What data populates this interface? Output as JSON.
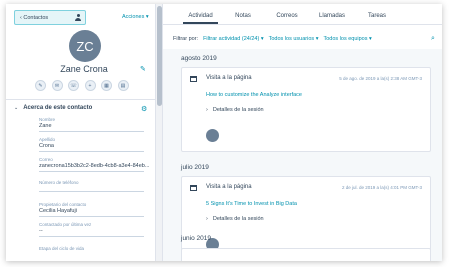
{
  "header": {
    "contacts_label": "‹ Contactos",
    "actions_label": "Acciones ▾"
  },
  "contact": {
    "initials": "ZC",
    "name": "Zane Crona"
  },
  "quick_actions": [
    "email-icon",
    "mail-icon",
    "phone-icon",
    "add-icon",
    "calendar-icon",
    "document-icon"
  ],
  "about": {
    "title": "Acerca de este contacto",
    "fields": [
      {
        "label": "Nombre",
        "value": "Zane"
      },
      {
        "label": "Apellido",
        "value": "Crona"
      },
      {
        "label": "Correo",
        "value": "zanecrona15b3b2c2-8edb-4cb8-a3e4-84eb..."
      },
      {
        "label": "Número de teléfono",
        "value": ""
      },
      {
        "label": "Propietario del contacto",
        "value": "Cecilia Hayafuji"
      },
      {
        "label": "Contactado por última vez",
        "value": "--"
      },
      {
        "label": "Etapa del ciclo de vida",
        "value": ""
      }
    ]
  },
  "tabs": [
    {
      "label": "Actividad",
      "active": true
    },
    {
      "label": "Notas",
      "active": false
    },
    {
      "label": "Correos",
      "active": false
    },
    {
      "label": "Llamadas",
      "active": false
    },
    {
      "label": "Tareas",
      "active": false
    }
  ],
  "filters": {
    "label": "Filtrar por:",
    "activity": "Filtrar actividad (24/24) ▾",
    "users": "Todos los usuarios ▾",
    "teams": "Todos los equipos ▾"
  },
  "timeline": [
    {
      "month": "agosto 2019",
      "title": "Visita a la página",
      "date": "5 de ago. de 2019 a la(s) 2:38 AM GMT-3",
      "link": "How to customize the Analyze interface",
      "details": "Detalles de la sesión"
    },
    {
      "month": "julio 2019",
      "title": "Visita a la página",
      "date": "2 de jul. de 2019 a la(s) 4:01 PM GMT-3",
      "link": "5 Signs It's Time to Invest in Big Data",
      "details": "Detalles de la sesión"
    },
    {
      "month": "junio 2019",
      "title": "",
      "date": "",
      "link": "",
      "details": ""
    }
  ],
  "colors": {
    "accent": "#0091ae",
    "text": "#33475b",
    "avatar": "#6a7f95",
    "timeline_bg": "#f5f8fa"
  }
}
